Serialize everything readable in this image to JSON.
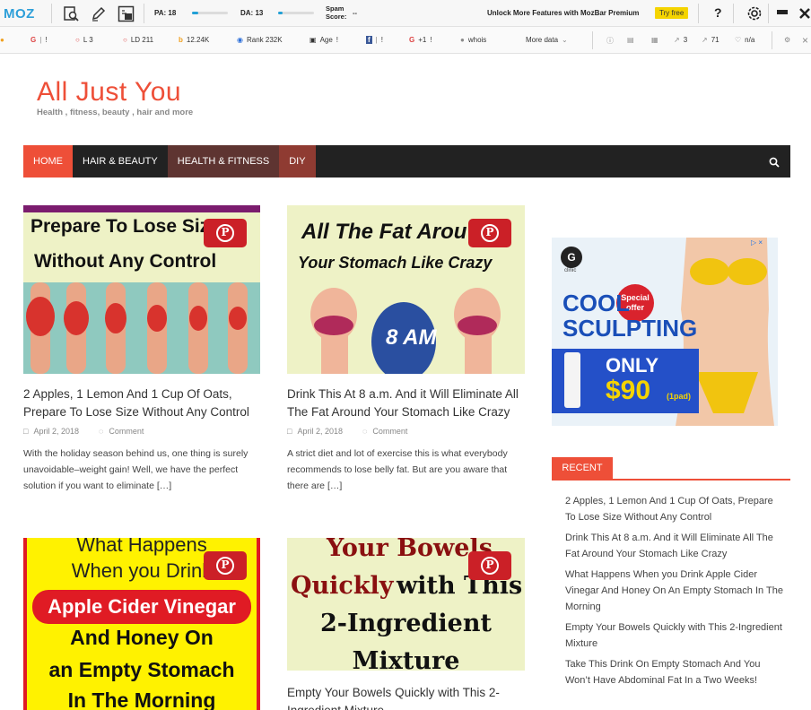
{
  "mozbar": {
    "logo": "MOZ",
    "pa_label": "PA: 18",
    "pa_fraction": 0.18,
    "da_label": "DA: 13",
    "da_fraction": 0.13,
    "spam_label": "Spam\nScore:",
    "spam_value": "--",
    "promo_text": "Unlock More Features with MozBar Premium",
    "try_free": "Try free",
    "help": "?",
    "row2": {
      "google_label": "G",
      "google_value": "!",
      "l_label": "L 3",
      "ld_label": "LD 211",
      "bing_value": "12.24K",
      "rank_label": "Rank 232K",
      "age_label": "Age",
      "age_value": "!",
      "facebook_value": "!",
      "gplus_label": "+1",
      "gplus_value": "!",
      "whois_label": "whois",
      "more_data": "More data",
      "links_value": "3",
      "fl_value": "71",
      "na_value": "n/a"
    }
  },
  "site": {
    "title": "All Just You",
    "tagline": "Health , fitness, beauty , hair and more"
  },
  "nav": {
    "items": [
      {
        "label": "HOME"
      },
      {
        "label": "HAIR & BEAUTY"
      },
      {
        "label": "HEALTH & FITNESS"
      },
      {
        "label": "DIY"
      }
    ]
  },
  "posts": [
    {
      "image_text": [
        "Prepare To Lose Size",
        "Without Any Control"
      ],
      "title": "2 Apples, 1 Lemon And 1 Cup Of Oats, Prepare To Lose Size Without Any Control",
      "date": "April 2, 2018",
      "comment": "Comment",
      "excerpt": "With the holiday season behind us, one thing is surely unavoidable–weight gain! Well, we have the perfect solution if you want to eliminate […]"
    },
    {
      "image_text": [
        "All The Fat Arou",
        "Your Stomach Like Crazy",
        "8 AM"
      ],
      "title": "Drink This At 8 a.m. And it Will Eliminate All The Fat Around Your Stomach Like Crazy",
      "date": "April 2, 2018",
      "comment": "Comment",
      "excerpt": "A strict diet and lot of exercise this is what everybody recommends to lose belly fat. But are you aware that there are […]"
    },
    {
      "image_text": [
        "What Happens",
        "When you Drink",
        "Apple Cider Vinegar",
        "And Honey On",
        "an Empty Stomach",
        "In The Morning"
      ],
      "title": "What Happens When you Drink Apple Cider Vinegar And Honey On An Empty Stomach In The Morning"
    },
    {
      "image_text": [
        "Your Bowels",
        "Quickly",
        "with This",
        "2-Ingredient",
        "Mixture"
      ],
      "title": "Empty Your Bowels Quickly with This 2-Ingredient Mixture"
    }
  ],
  "ad": {
    "brand": "G",
    "brand_sub": "clinic",
    "headline1": "COOL",
    "headline2": "SCULPTING",
    "badge": "Special offer",
    "only": "ONLY",
    "price": "$90",
    "unit": "(1pad)"
  },
  "sidebar": {
    "recent_label": "RECENT",
    "recent": [
      "2 Apples, 1 Lemon And 1 Cup Of Oats, Prepare To Lose Size Without Any Control",
      "Drink This At 8 a.m. And it Will Eliminate All The Fat Around Your Stomach Like Crazy",
      "What Happens When you Drink Apple Cider Vinegar And Honey On An Empty Stomach In The Morning",
      "Empty Your Bowels Quickly with This 2-Ingredient Mixture",
      "Take This Drink On Empty Stomach And You Won’t Have Abdominal Fat In a Two Weeks!"
    ]
  },
  "colors": {
    "accent": "#ee4f38",
    "nav_bg": "#222222",
    "pinterest": "#cb2027",
    "moz_blue": "#2d9fd9"
  }
}
